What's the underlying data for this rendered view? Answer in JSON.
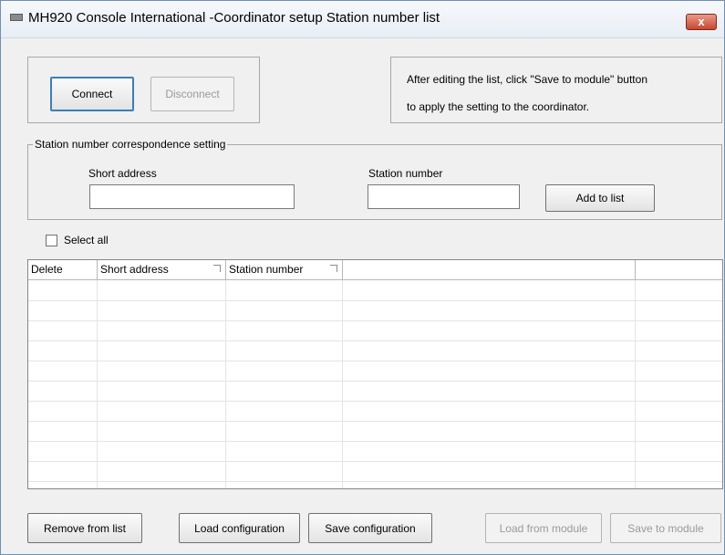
{
  "window": {
    "title": "MH920 Console International -Coordinator setup Station number list",
    "close_label": "x"
  },
  "connection": {
    "connect_label": "Connect",
    "disconnect_label": "Disconnect"
  },
  "info": {
    "line1": "After editing the list, click \"Save to module\" button",
    "line2": "to apply the setting to the coordinator."
  },
  "station_setting": {
    "legend": "Station number correspondence setting",
    "short_address_label": "Short address",
    "short_address_value": "",
    "station_number_label": "Station number",
    "station_number_value": "",
    "add_button": "Add to list"
  },
  "select_all": {
    "label": "Select all",
    "checked": false
  },
  "table": {
    "columns": [
      "Delete",
      "Short address",
      "Station number",
      "",
      ""
    ],
    "rows": []
  },
  "bottom_buttons": {
    "remove": "Remove from list",
    "load_config": "Load configuration",
    "save_config": "Save configuration",
    "load_module": "Load from module",
    "save_module": "Save to module"
  },
  "icons": {
    "app": "app-icon",
    "close": "close-icon",
    "sort": "sort-icon"
  }
}
